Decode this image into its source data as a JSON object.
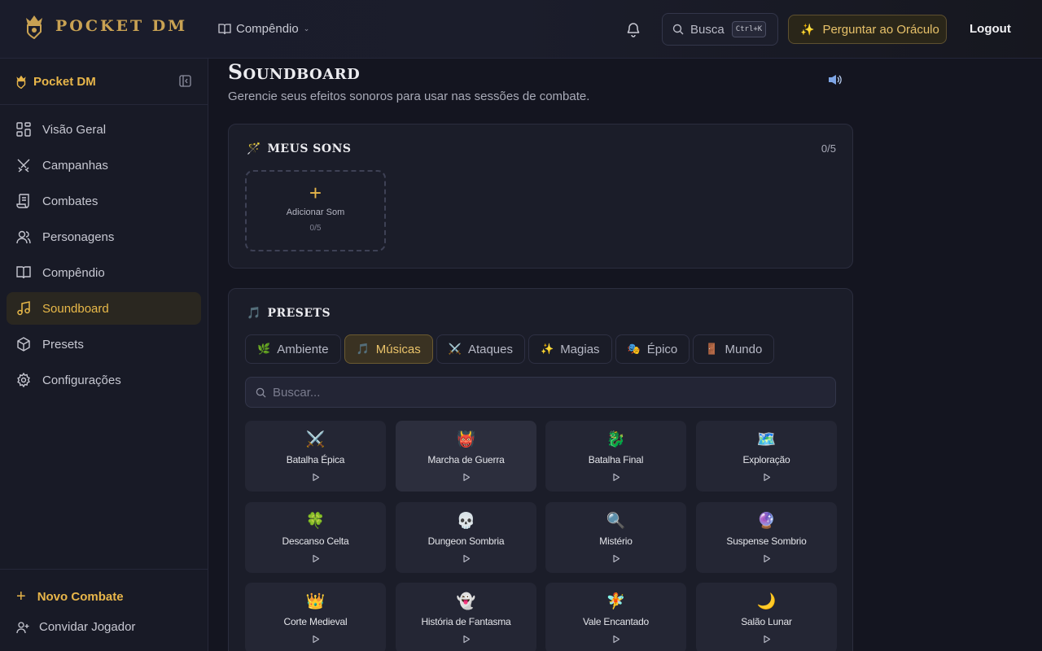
{
  "header": {
    "brand": "POCKET DM",
    "compendio": "Compêndio",
    "search_label": "Busca",
    "search_shortcut": "Ctrl+K",
    "oracle_label": "Perguntar ao Oráculo",
    "logout": "Logout"
  },
  "sidebar": {
    "title": "Pocket DM",
    "items": [
      {
        "label": "Visão Geral",
        "icon": "grid-icon"
      },
      {
        "label": "Campanhas",
        "icon": "crossed-swords-icon"
      },
      {
        "label": "Combates",
        "icon": "scroll-icon"
      },
      {
        "label": "Personagens",
        "icon": "users-icon"
      },
      {
        "label": "Compêndio",
        "icon": "book-icon"
      },
      {
        "label": "Soundboard",
        "icon": "music-note-icon",
        "active": true
      },
      {
        "label": "Presets",
        "icon": "box-icon"
      },
      {
        "label": "Configurações",
        "icon": "gear-icon"
      }
    ],
    "new_combat": "Novo Combate",
    "invite": "Convidar Jogador"
  },
  "main": {
    "title": "Soundboard",
    "subtitle": "Gerencie seus efeitos sonoros para usar nas sessões de combate.",
    "my_sounds": {
      "title": "MEUS SONS",
      "count": "0/5",
      "add_label": "Adicionar Som",
      "add_count": "0/5"
    },
    "presets": {
      "title": "PRESETS",
      "tabs": [
        {
          "label": "Ambiente",
          "emoji": "🌿"
        },
        {
          "label": "Músicas",
          "emoji": "🎵",
          "active": true
        },
        {
          "label": "Ataques",
          "emoji": "⚔️"
        },
        {
          "label": "Magias",
          "emoji": "✨"
        },
        {
          "label": "Épico",
          "emoji": "🎭"
        },
        {
          "label": "Mundo",
          "emoji": "🚪"
        }
      ],
      "search_placeholder": "Buscar...",
      "tiles": [
        {
          "name": "Batalha Épica",
          "emoji": "⚔️"
        },
        {
          "name": "Marcha de Guerra",
          "emoji": "👹"
        },
        {
          "name": "Batalha Final",
          "emoji": "🐉"
        },
        {
          "name": "Exploração",
          "emoji": "🗺️"
        },
        {
          "name": "Descanso Celta",
          "emoji": "🍀"
        },
        {
          "name": "Dungeon Sombria",
          "emoji": "💀"
        },
        {
          "name": "Mistério",
          "emoji": "🔍"
        },
        {
          "name": "Suspense Sombrio",
          "emoji": "🔮"
        },
        {
          "name": "Corte Medieval",
          "emoji": "👑"
        },
        {
          "name": "História de Fantasma",
          "emoji": "👻"
        },
        {
          "name": "Vale Encantado",
          "emoji": "🧚"
        },
        {
          "name": "Salão Lunar",
          "emoji": "🌙"
        }
      ]
    }
  },
  "colors": {
    "accent": "#e8b64a",
    "background": "#141520",
    "card": "#1b1d29"
  }
}
